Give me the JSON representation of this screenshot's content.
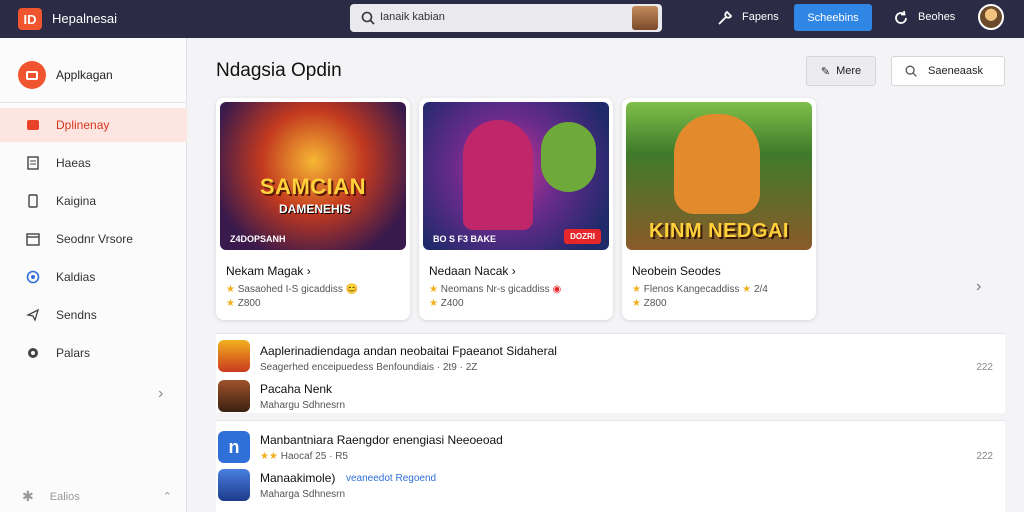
{
  "header": {
    "brand_logo": "ID",
    "brand": "Hepalnesai",
    "search_placeholder": "Ianaik kabian",
    "link1": "Fapens",
    "button": "Scheebins",
    "link2": "Beohes"
  },
  "sidebar": {
    "title": "Applkagan",
    "items": [
      {
        "label": "Dplinenay",
        "icon": "grid-icon",
        "active": true
      },
      {
        "label": "Haeas",
        "icon": "document-icon"
      },
      {
        "label": "Kaigina",
        "icon": "tablet-icon"
      },
      {
        "label": "Seodnr Vrsore",
        "icon": "calendar-icon"
      },
      {
        "label": "Kaldias",
        "icon": "headset-icon"
      },
      {
        "label": "Sendns",
        "icon": "send-icon"
      },
      {
        "label": "Palars",
        "icon": "settings-icon"
      }
    ],
    "footer": "Ealios"
  },
  "main": {
    "title": "Ndagsia Opdin",
    "more_button": "Mere",
    "search_button": "Saeneaask",
    "cards": [
      {
        "art_title": "SAMCIAN",
        "art_sub": "DAMENEHIS",
        "caption": "Z4DOPSANH",
        "name": "Nekam Magak ›",
        "meta": "Sasaohed I-S gicaddiss",
        "rating": "Z800"
      },
      {
        "art_title": "",
        "art_sub": "",
        "caption": "BO S F3 BAKE",
        "badge": "DOZRI",
        "name": "Nedaan Nacak ›",
        "meta": "Neomans Nr-s gicaddiss",
        "rating": "Z400"
      },
      {
        "art_title": "KINM NEDGAI",
        "art_sub": "",
        "caption": "",
        "name": "Neobein Seodes",
        "meta": "Flenos Kangecaddiss",
        "extra": "2/4",
        "rating": "Z800"
      }
    ],
    "list1": {
      "title": "Aaplerinadiendaga andan neobaitai Fpaeanot Sidaheral",
      "sub": "Seagerhed enceipuedess Benfoundiais · 2t9 · 2Z",
      "end": "222",
      "title2": "Pacaha Nenk",
      "sub2": "Mahargu Sdhnesrn"
    },
    "list2": {
      "title": "Manbantniara Raengdor enengiasi Neeoeoad",
      "sub": "Haocaf 25 · R5",
      "end": "222",
      "title2": "Manaakimole)",
      "sub2": "veaneedot Regoend",
      "sub3": "Maharga Sdhnesrn"
    }
  }
}
